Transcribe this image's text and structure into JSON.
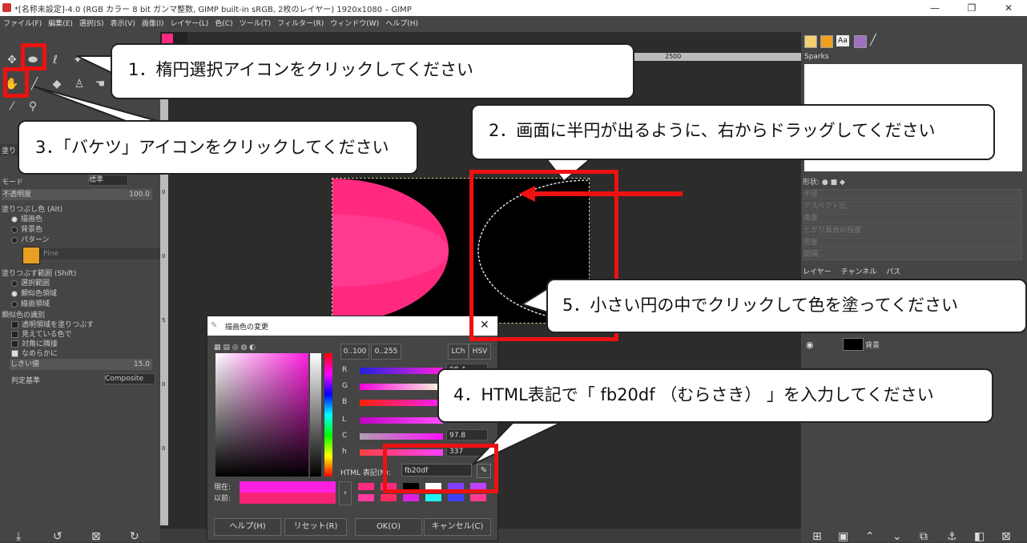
{
  "titlebar": {
    "title": "*[名称未設定]-4.0 (RGB カラー 8 bit ガンマ整数, GIMP built-in sRGB, 2枚のレイヤー) 1920x1080 – GIMP",
    "minimize": "—",
    "maximize": "❐",
    "close": "✕"
  },
  "menu": [
    "ファイル(F)",
    "編集(E)",
    "選択(S)",
    "表示(V)",
    "画像(I)",
    "レイヤー(L)",
    "色(C)",
    "ツール(T)",
    "フィルター(R)",
    "ウィンドウ(W)",
    "ヘルプ(H)"
  ],
  "toolbox": {
    "tab_label": "塗り",
    "mode_label": "モード",
    "mode_value": "標準",
    "opacity_label": "不透明度",
    "opacity_value": "100.0",
    "fill_color_label": "塗りつぶし色 (Alt)",
    "fill_options": [
      "描画色",
      "背景色",
      "パターン"
    ],
    "pattern_name": "Pine",
    "fill_range_label": "塗りつぶす範囲 (Shift)",
    "range_options": [
      "選択範囲",
      "類似色領域",
      "線画領域"
    ],
    "similar_label": "類似色の識別",
    "similar_options": [
      "透明領域を塗りつぶす",
      "見えている色で",
      "対角に隣接",
      "なめらかに"
    ],
    "threshold_label": "しきい値",
    "threshold_value": "15.0",
    "criterion_label": "判定基準",
    "criterion_value": "Composite"
  },
  "rulers": {
    "top_mark": "2500",
    "left_marks": [
      "0",
      "0",
      "5",
      "0",
      "0"
    ]
  },
  "right_dock": {
    "brush_name": "Sparks",
    "shape_label": "形状:",
    "dynamics_labels": [
      "半径",
      "アスペクト比",
      "角度",
      "とがり具合の程度",
      "密度",
      "間隔"
    ],
    "layers_tabs": [
      "レイヤー",
      "チャンネル",
      "パス"
    ],
    "layer_name": "背景"
  },
  "dialog": {
    "title": "描画色の変更",
    "range_btn_1": "0..100",
    "range_btn_2": "0..255",
    "lch_btn": "LCh",
    "hsv_btn": "HSV",
    "channels": [
      {
        "label": "R",
        "value": "98.4"
      },
      {
        "label": "G",
        "value": ""
      },
      {
        "label": "B",
        "value": ""
      },
      {
        "label": "L",
        "value": ""
      },
      {
        "label": "C",
        "value": "97.8"
      },
      {
        "label": "h",
        "value": "337"
      }
    ],
    "html_label": "HTML 表記(N):",
    "html_value": "fb20df",
    "current_label": "現在:",
    "previous_label": "以前:",
    "current_color": "#fb20df",
    "previous_color": "#f72375",
    "help_btn": "ヘルプ(H)",
    "reset_btn": "リセット(R)",
    "ok_btn": "OK(O)",
    "cancel_btn": "キャンセル(C)"
  },
  "callouts": {
    "c1": "1．楕円選択アイコンをクリックしてください",
    "c2": "2．画面に半円が出るように、右からドラッグしてください",
    "c3": "3．「バケツ」アイコンをクリックしてください",
    "c4": "4．HTML表記で「 fb20df （むらさき） 」を入力してください",
    "c5": "5．小さい円の中でクリックして色を塗ってください"
  },
  "colors": {
    "accent_red": "#ee1111",
    "pink_fill": "#ff2a80",
    "panel_bg": "#454545"
  }
}
